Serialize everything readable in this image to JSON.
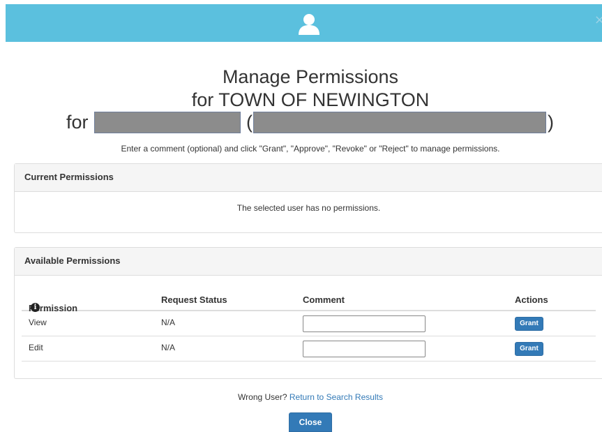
{
  "header": {
    "icon": "user-icon",
    "close_glyph": "×",
    "color": "#5bc0de"
  },
  "title": {
    "line1": "Manage Permissions",
    "line2": "for TOWN OF NEWINGTON",
    "for_word": "for",
    "paren_open": "(",
    "paren_close": ")"
  },
  "instructions": "Enter a comment (optional) and click \"Grant\", \"Approve\", \"Revoke\" or \"Reject\" to manage permissions.",
  "current_permissions": {
    "heading": "Current Permissions",
    "empty_message": "The selected user has no permissions."
  },
  "available_permissions": {
    "heading": "Available Permissions",
    "columns": {
      "permission": "Permission",
      "request_status": "Request Status",
      "comment": "Comment",
      "actions": "Actions"
    },
    "info_icon": "info-icon",
    "rows": [
      {
        "permission": "View",
        "status": "N/A",
        "comment": "",
        "action": "Grant"
      },
      {
        "permission": "Edit",
        "status": "N/A",
        "comment": "",
        "action": "Grant"
      }
    ]
  },
  "footer": {
    "wrong_user_text": "Wrong User?",
    "return_link": "Return to Search Results",
    "close_label": "Close"
  },
  "colors": {
    "primary": "#337ab7",
    "header": "#5bc0de",
    "redaction": "#8c8c8c"
  }
}
